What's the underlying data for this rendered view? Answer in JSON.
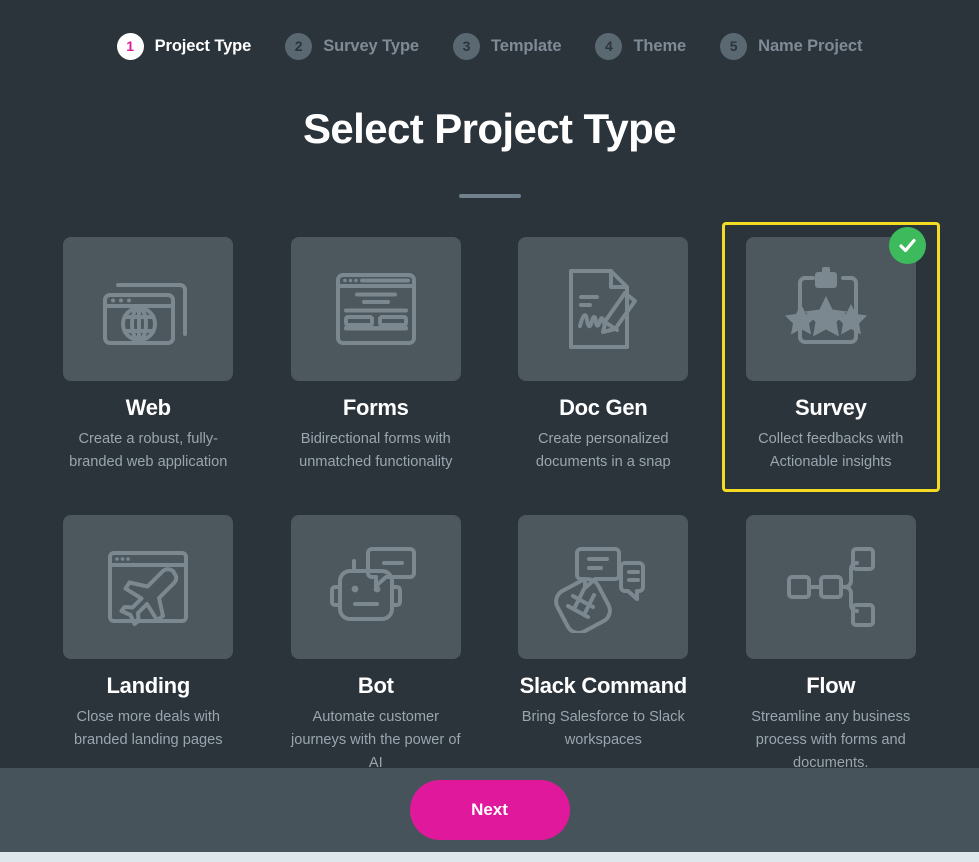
{
  "stepper": {
    "steps": [
      {
        "number": "1",
        "label": "Project Type",
        "active": true
      },
      {
        "number": "2",
        "label": "Survey Type",
        "active": false
      },
      {
        "number": "3",
        "label": "Template",
        "active": false
      },
      {
        "number": "4",
        "label": "Theme",
        "active": false
      },
      {
        "number": "5",
        "label": "Name Project",
        "active": false
      }
    ]
  },
  "header": {
    "title": "Select Project Type"
  },
  "cards": [
    {
      "title": "Web",
      "description": "Create a robust, fully-branded web application",
      "icon": "browser-globe-icon",
      "selected": false
    },
    {
      "title": "Forms",
      "description": "Bidirectional forms with unmatched functionality",
      "icon": "form-window-icon",
      "selected": false
    },
    {
      "title": "Doc Gen",
      "description": "Create personalized documents in a snap",
      "icon": "document-pencil-icon",
      "selected": false
    },
    {
      "title": "Survey",
      "description": "Collect feedbacks with Actionable insights",
      "icon": "clipboard-stars-icon",
      "selected": true
    },
    {
      "title": "Landing",
      "description": "Close more deals with branded landing pages",
      "icon": "browser-airplane-icon",
      "selected": false
    },
    {
      "title": "Bot",
      "description": "Automate customer journeys with the power of AI",
      "icon": "robot-chat-icon",
      "selected": false
    },
    {
      "title": "Slack Command",
      "description": "Bring Salesforce to Slack workspaces",
      "icon": "slack-hashtag-chat-icon",
      "selected": false
    },
    {
      "title": "Flow",
      "description": "Streamline any business process with forms and documents.",
      "icon": "flowchart-nodes-icon",
      "selected": false
    }
  ],
  "footer": {
    "next_label": "Next"
  },
  "colors": {
    "background": "#2b333b",
    "tile": "#4d585e",
    "accent_pink": "#e0189b",
    "selection_border": "#f5dc22",
    "check_green": "#3dba5b",
    "footer_bar": "#46535a",
    "bottom_strip": "#dde7ec"
  }
}
